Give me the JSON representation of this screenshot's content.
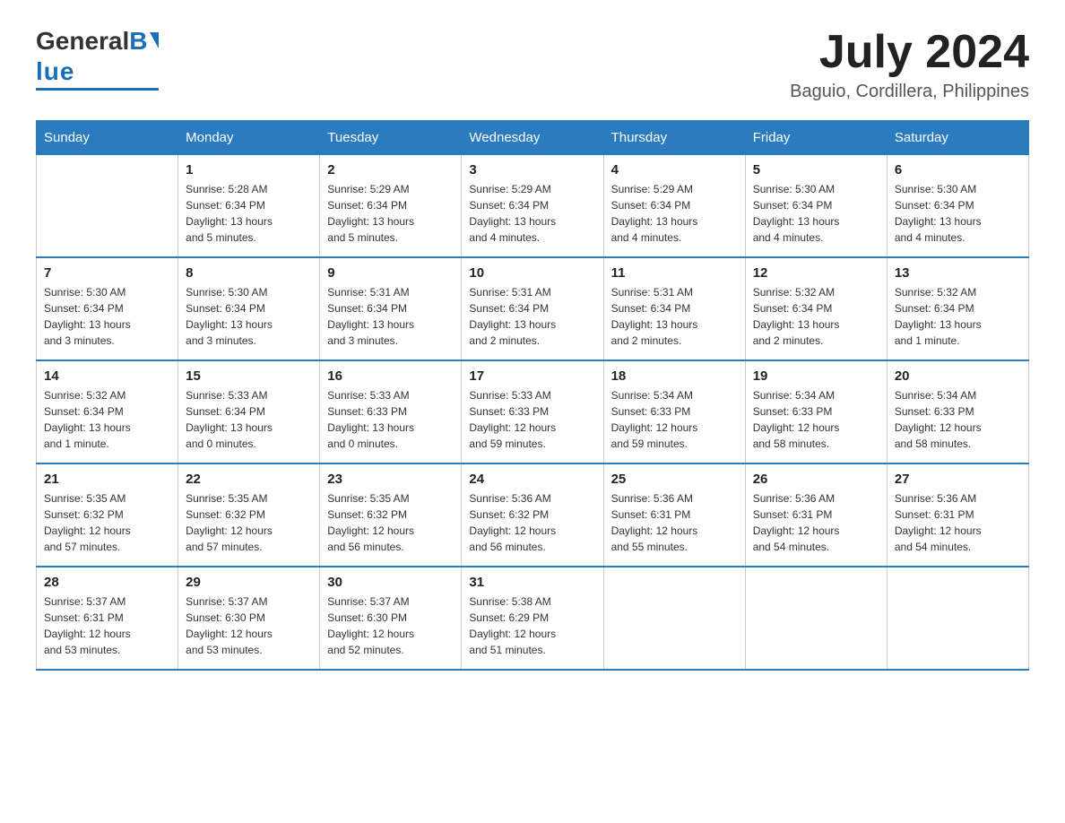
{
  "logo": {
    "general": "General",
    "blue": "Blue"
  },
  "title": {
    "month_year": "July 2024",
    "location": "Baguio, Cordillera, Philippines"
  },
  "headers": [
    "Sunday",
    "Monday",
    "Tuesday",
    "Wednesday",
    "Thursday",
    "Friday",
    "Saturday"
  ],
  "weeks": [
    [
      {
        "day": "",
        "info": ""
      },
      {
        "day": "1",
        "info": "Sunrise: 5:28 AM\nSunset: 6:34 PM\nDaylight: 13 hours\nand 5 minutes."
      },
      {
        "day": "2",
        "info": "Sunrise: 5:29 AM\nSunset: 6:34 PM\nDaylight: 13 hours\nand 5 minutes."
      },
      {
        "day": "3",
        "info": "Sunrise: 5:29 AM\nSunset: 6:34 PM\nDaylight: 13 hours\nand 4 minutes."
      },
      {
        "day": "4",
        "info": "Sunrise: 5:29 AM\nSunset: 6:34 PM\nDaylight: 13 hours\nand 4 minutes."
      },
      {
        "day": "5",
        "info": "Sunrise: 5:30 AM\nSunset: 6:34 PM\nDaylight: 13 hours\nand 4 minutes."
      },
      {
        "day": "6",
        "info": "Sunrise: 5:30 AM\nSunset: 6:34 PM\nDaylight: 13 hours\nand 4 minutes."
      }
    ],
    [
      {
        "day": "7",
        "info": "Sunrise: 5:30 AM\nSunset: 6:34 PM\nDaylight: 13 hours\nand 3 minutes."
      },
      {
        "day": "8",
        "info": "Sunrise: 5:30 AM\nSunset: 6:34 PM\nDaylight: 13 hours\nand 3 minutes."
      },
      {
        "day": "9",
        "info": "Sunrise: 5:31 AM\nSunset: 6:34 PM\nDaylight: 13 hours\nand 3 minutes."
      },
      {
        "day": "10",
        "info": "Sunrise: 5:31 AM\nSunset: 6:34 PM\nDaylight: 13 hours\nand 2 minutes."
      },
      {
        "day": "11",
        "info": "Sunrise: 5:31 AM\nSunset: 6:34 PM\nDaylight: 13 hours\nand 2 minutes."
      },
      {
        "day": "12",
        "info": "Sunrise: 5:32 AM\nSunset: 6:34 PM\nDaylight: 13 hours\nand 2 minutes."
      },
      {
        "day": "13",
        "info": "Sunrise: 5:32 AM\nSunset: 6:34 PM\nDaylight: 13 hours\nand 1 minute."
      }
    ],
    [
      {
        "day": "14",
        "info": "Sunrise: 5:32 AM\nSunset: 6:34 PM\nDaylight: 13 hours\nand 1 minute."
      },
      {
        "day": "15",
        "info": "Sunrise: 5:33 AM\nSunset: 6:34 PM\nDaylight: 13 hours\nand 0 minutes."
      },
      {
        "day": "16",
        "info": "Sunrise: 5:33 AM\nSunset: 6:33 PM\nDaylight: 13 hours\nand 0 minutes."
      },
      {
        "day": "17",
        "info": "Sunrise: 5:33 AM\nSunset: 6:33 PM\nDaylight: 12 hours\nand 59 minutes."
      },
      {
        "day": "18",
        "info": "Sunrise: 5:34 AM\nSunset: 6:33 PM\nDaylight: 12 hours\nand 59 minutes."
      },
      {
        "day": "19",
        "info": "Sunrise: 5:34 AM\nSunset: 6:33 PM\nDaylight: 12 hours\nand 58 minutes."
      },
      {
        "day": "20",
        "info": "Sunrise: 5:34 AM\nSunset: 6:33 PM\nDaylight: 12 hours\nand 58 minutes."
      }
    ],
    [
      {
        "day": "21",
        "info": "Sunrise: 5:35 AM\nSunset: 6:32 PM\nDaylight: 12 hours\nand 57 minutes."
      },
      {
        "day": "22",
        "info": "Sunrise: 5:35 AM\nSunset: 6:32 PM\nDaylight: 12 hours\nand 57 minutes."
      },
      {
        "day": "23",
        "info": "Sunrise: 5:35 AM\nSunset: 6:32 PM\nDaylight: 12 hours\nand 56 minutes."
      },
      {
        "day": "24",
        "info": "Sunrise: 5:36 AM\nSunset: 6:32 PM\nDaylight: 12 hours\nand 56 minutes."
      },
      {
        "day": "25",
        "info": "Sunrise: 5:36 AM\nSunset: 6:31 PM\nDaylight: 12 hours\nand 55 minutes."
      },
      {
        "day": "26",
        "info": "Sunrise: 5:36 AM\nSunset: 6:31 PM\nDaylight: 12 hours\nand 54 minutes."
      },
      {
        "day": "27",
        "info": "Sunrise: 5:36 AM\nSunset: 6:31 PM\nDaylight: 12 hours\nand 54 minutes."
      }
    ],
    [
      {
        "day": "28",
        "info": "Sunrise: 5:37 AM\nSunset: 6:31 PM\nDaylight: 12 hours\nand 53 minutes."
      },
      {
        "day": "29",
        "info": "Sunrise: 5:37 AM\nSunset: 6:30 PM\nDaylight: 12 hours\nand 53 minutes."
      },
      {
        "day": "30",
        "info": "Sunrise: 5:37 AM\nSunset: 6:30 PM\nDaylight: 12 hours\nand 52 minutes."
      },
      {
        "day": "31",
        "info": "Sunrise: 5:38 AM\nSunset: 6:29 PM\nDaylight: 12 hours\nand 51 minutes."
      },
      {
        "day": "",
        "info": ""
      },
      {
        "day": "",
        "info": ""
      },
      {
        "day": "",
        "info": ""
      }
    ]
  ]
}
